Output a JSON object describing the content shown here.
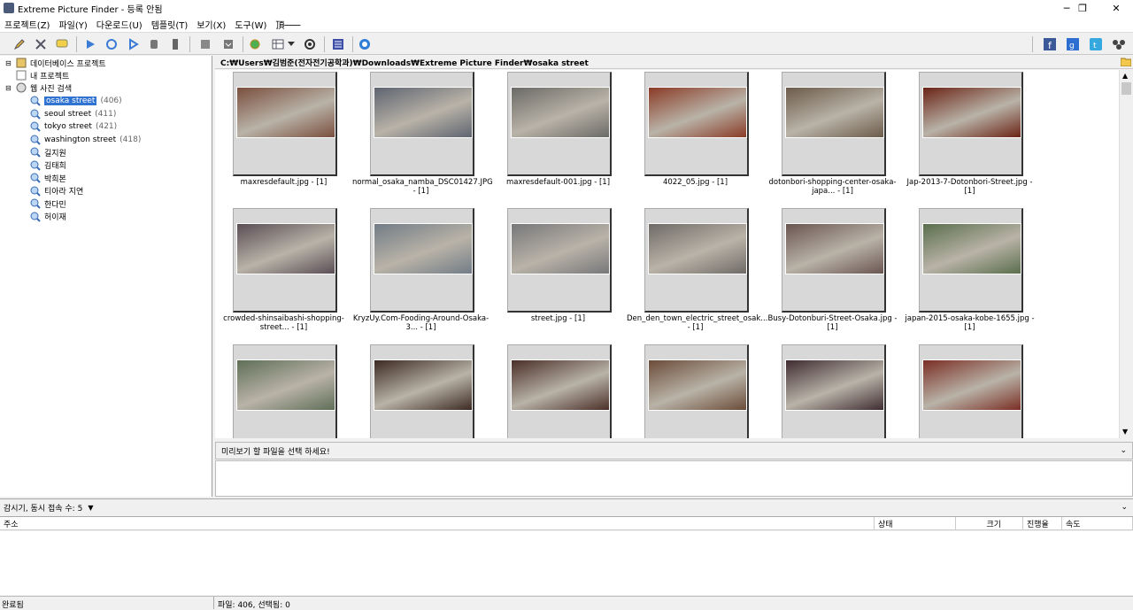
{
  "window": {
    "title": "Extreme Picture Finder - 등록 안됨",
    "minimize": "─",
    "maximize": "❐",
    "close": "✕"
  },
  "menu": [
    "프로젝트(Z)",
    "파일(Y)",
    "다운로드(U)",
    "템플릿(T)",
    "보기(X)",
    "도구(W)",
    "頂───"
  ],
  "tree": {
    "db_projects": "데이터베이스 프로젝트",
    "my_projects": "내 프로젝트",
    "web_search": "웹 사진 검색",
    "items": [
      {
        "label": "osaka street",
        "count": "(406)",
        "selected": true
      },
      {
        "label": "seoul street",
        "count": "(411)"
      },
      {
        "label": "tokyo street",
        "count": "(421)"
      },
      {
        "label": "washington street",
        "count": "(418)"
      },
      {
        "label": "길지원",
        "count": ""
      },
      {
        "label": "김태희",
        "count": ""
      },
      {
        "label": "박희본",
        "count": ""
      },
      {
        "label": "티아라 지연",
        "count": ""
      },
      {
        "label": "한다민",
        "count": ""
      },
      {
        "label": "허이재",
        "count": ""
      }
    ]
  },
  "path": "C:₩Users₩김범준(전자전기공학과)₩Downloads₩Extreme Picture Finder₩osaka street",
  "thumbnails": [
    {
      "caption": "maxresdefault.jpg - [1]",
      "color": "#7a4f3e"
    },
    {
      "caption": "normal_osaka_namba_DSC01427.JPG - [1]",
      "color": "#5e6470"
    },
    {
      "caption": "maxresdefault-001.jpg - [1]",
      "color": "#6b6a66"
    },
    {
      "caption": "4022_05.jpg - [1]",
      "color": "#8a3b26"
    },
    {
      "caption": "dotonbori-shopping-center-osaka-japa... - [1]",
      "color": "#6c5b4a"
    },
    {
      "caption": "Jap-2013-7-Dotonbori-Street.jpg - [1]",
      "color": "#6a2416"
    },
    {
      "caption": "crowded-shinsaibashi-shopping-street... - [1]",
      "color": "#5a4e55"
    },
    {
      "caption": "KryzUy.Com-Fooding-Around-Osaka-3... - [1]",
      "color": "#727c86"
    },
    {
      "caption": "street.jpg - [1]",
      "color": "#77777a"
    },
    {
      "caption": "Den_den_town_electric_street_osak... - [1]",
      "color": "#6f6a66"
    },
    {
      "caption": "Busy-Dotonburi-Street-Osaka.jpg - [1]",
      "color": "#6a5550"
    },
    {
      "caption": "japan-2015-osaka-kobe-1655.jpg - [1]",
      "color": "#5a6e4c"
    },
    {
      "caption": "",
      "color": "#5f6e57"
    },
    {
      "caption": "",
      "color": "#3c2a22"
    },
    {
      "caption": "",
      "color": "#4a2f28"
    },
    {
      "caption": "",
      "color": "#6b4c38"
    },
    {
      "caption": "",
      "color": "#3f2c32"
    },
    {
      "caption": "",
      "color": "#7a2e24"
    }
  ],
  "preview": {
    "message": "미리보기 할 파일을 선택 하세요!"
  },
  "monitor": {
    "label": "감시기, 동시 접속 수: 5"
  },
  "downloads": {
    "columns": [
      "주소",
      "상태",
      "크기",
      "진행율",
      "속도"
    ]
  },
  "status": {
    "left": "완료됨",
    "right": "파일: 406, 선택됨: 0"
  }
}
